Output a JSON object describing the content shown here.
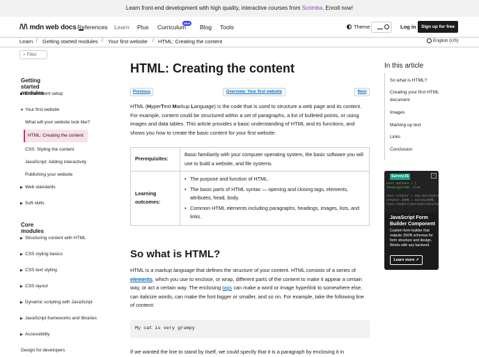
{
  "banner": {
    "text_prefix": "Learn front-end development with high quality, interactive courses from ",
    "link": "Scrimba",
    "text_suffix": ". Enroll now!"
  },
  "nav": {
    "logo_mark": "/\\/\\",
    "logo_text": "mdn web docs",
    "items": [
      "References",
      "Learn",
      "Plus",
      "Curriculum",
      "Blog",
      "Tools"
    ],
    "new_badge": "NEW",
    "theme": "Theme",
    "login": "Log in",
    "signup": "Sign up for free"
  },
  "breadcrumb": {
    "items": [
      "Learn",
      "Getting started modules",
      "Your first website",
      "HTML: Creating the content"
    ],
    "separator": "/",
    "language": "English (US)"
  },
  "sidebar": {
    "filter": "Filter",
    "section1": "Getting started modules",
    "s1_items": [
      "Environment setup",
      "Your first website"
    ],
    "sub_items": [
      "What will your website look like?",
      "HTML: Creating the content",
      "CSS: Styling the content",
      "JavaScript: Adding interactivity",
      "Publishing your website"
    ],
    "s1_tail": [
      "Web standards",
      "Soft skills"
    ],
    "section2": "Core modules",
    "s2_items": [
      "Structuring content with HTML",
      "CSS styling basics",
      "CSS text styling",
      "CSS layout",
      "Dynamic scripting with JavaScript",
      "JavaScript frameworks and libraries",
      "Accessibility"
    ],
    "footer_item": "Design for developers"
  },
  "main": {
    "title": "HTML: Creating the content",
    "prev": "Previous",
    "overview": "Overview: Your first website",
    "next": "Next",
    "intro": {
      "p1": "HTML (",
      "b1": "H",
      "t1": "yper",
      "b2": "T",
      "t2": "ext ",
      "b3": "M",
      "t3": "arkup ",
      "b4": "L",
      "t4": "anguage) is the code that is used to structure a web page and its content. For example, content could be structured within a set of paragraphs, a list of bulleted points, or using images and data tables. This article provides a basic understanding of HTML and its functions, and shows you how to create the basic content for your first website."
    },
    "prereq_label": "Prerequisites:",
    "prereq_text": "Basic familiarity with your computer operating system, the basic software you will use to build a website, and file systems.",
    "outcomes_label": "Learning outcomes:",
    "outcomes": [
      "The purpose and function of HTML.",
      "The basic parts of HTML syntax — opening and closing tags, elements, attributes, head, body.",
      "Common HTML elements including paragraphs, headings, images, lists, and links."
    ],
    "h2": "So what is HTML?",
    "p2": {
      "a": "HTML is a ",
      "em": "markup language",
      "b": " that defines the structure of your content. HTML consists of a series of ",
      "link1": "elements",
      "c": ", which you use to enclose, or wrap, different parts of the content to make it appear a certain way, or act a certain way. The enclosing ",
      "link2": "tags",
      "d": " can make a word or image hyperlink to somewhere else, can italicize words, can make the font bigger or smaller, and so on. For example, take the following line of content:"
    },
    "code": "My cat is very grumpy",
    "p3": "If we wanted the line to stand by itself, we could specify that it is a paragraph by enclosing it in"
  },
  "toc": {
    "title": "In this article",
    "items": [
      "So what is HTML?",
      "Creating your first HTML document",
      "Images",
      "Marking up text",
      "Links",
      "Conclusion"
    ]
  },
  "ad": {
    "brand": "SurveyJS",
    "code_lines": [
      "  onst options = {",
      "  showLogicTab: true",
      "",
      "  onst creator = new SurveyCreator",
      "  creator.JSON = surveyJSON;",
      "  root.render(<SurveyCreatorComponent"
    ],
    "title": "JavaScript Form Builder Component",
    "body": "Custom form builder that outputs JSON schemas for form structure and design. Works with any backend.",
    "cta": "Learn more",
    "close": "×"
  }
}
